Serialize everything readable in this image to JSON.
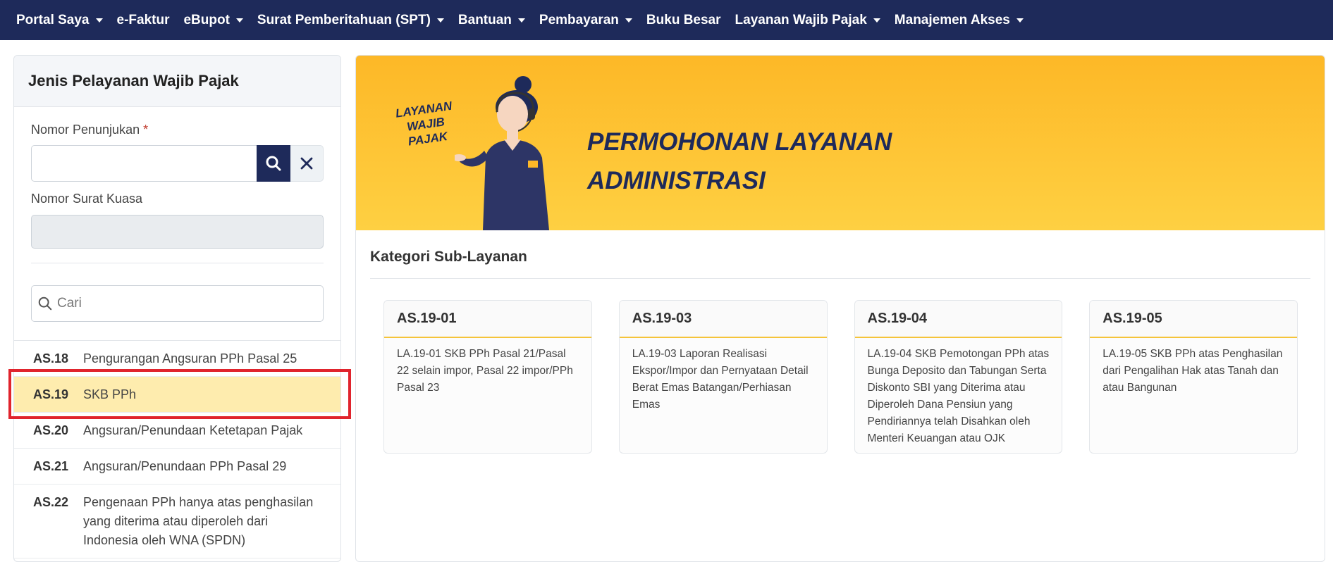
{
  "nav": [
    {
      "label": "Portal Saya",
      "caret": true
    },
    {
      "label": "e-Faktur",
      "caret": false
    },
    {
      "label": "eBupot",
      "caret": true
    },
    {
      "label": "Surat Pemberitahuan (SPT)",
      "caret": true
    },
    {
      "label": "Bantuan",
      "caret": true
    },
    {
      "label": "Pembayaran",
      "caret": true
    },
    {
      "label": "Buku Besar",
      "caret": false
    },
    {
      "label": "Layanan Wajib Pajak",
      "caret": true
    },
    {
      "label": "Manajemen Akses",
      "caret": true
    }
  ],
  "left": {
    "title": "Jenis Pelayanan Wajib Pajak",
    "nomor_penunjukan_label": "Nomor Penunjukan",
    "required_mark": "*",
    "nomor_surat_kuasa_label": "Nomor Surat Kuasa",
    "search_placeholder": "Cari",
    "items": [
      {
        "code": "AS.18",
        "name": "Pengurangan Angsuran PPh Pasal 25",
        "active": false
      },
      {
        "code": "AS.19",
        "name": "SKB PPh",
        "active": true
      },
      {
        "code": "AS.20",
        "name": "Angsuran/Penundaan Ketetapan Pajak",
        "active": false
      },
      {
        "code": "AS.21",
        "name": "Angsuran/Penundaan PPh Pasal 29",
        "active": false
      },
      {
        "code": "AS.22",
        "name": "Pengenaan PPh hanya atas penghasilan yang diterima atau diperoleh dari Indonesia oleh WNA (SPDN)",
        "active": false
      }
    ]
  },
  "banner": {
    "tag_lines": [
      "LAYANAN",
      "WAJIB",
      "PAJAK"
    ],
    "title_line1": "PERMOHONAN LAYANAN",
    "title_line2": "ADMINISTRASI"
  },
  "right": {
    "sub_title": "Kategori Sub-Layanan",
    "cards": [
      {
        "code": "AS.19-01",
        "desc": "LA.19-01 SKB PPh Pasal 21/Pasal 22 selain impor, Pasal 22 impor/PPh Pasal 23"
      },
      {
        "code": "AS.19-03",
        "desc": "LA.19-03 Laporan Realisasi Ekspor/Impor dan Pernyataan Detail Berat Emas Batangan/Perhiasan Emas"
      },
      {
        "code": "AS.19-04",
        "desc": "LA.19-04 SKB Pemotongan PPh atas Bunga Deposito dan Tabungan Serta Diskonto SBI yang Diterima atau Diperoleh Dana Pensiun yang Pendiriannya telah Disahkan oleh Menteri Keuangan atau OJK"
      },
      {
        "code": "AS.19-05",
        "desc": "LA.19-05 SKB PPh atas Penghasilan dari Pengalihan Hak atas Tanah dan atau Bangunan"
      }
    ]
  },
  "colors": {
    "navy": "#1e2a5a",
    "accent": "#fdb827",
    "active_row": "#feecae",
    "highlight": "#e0242d"
  }
}
